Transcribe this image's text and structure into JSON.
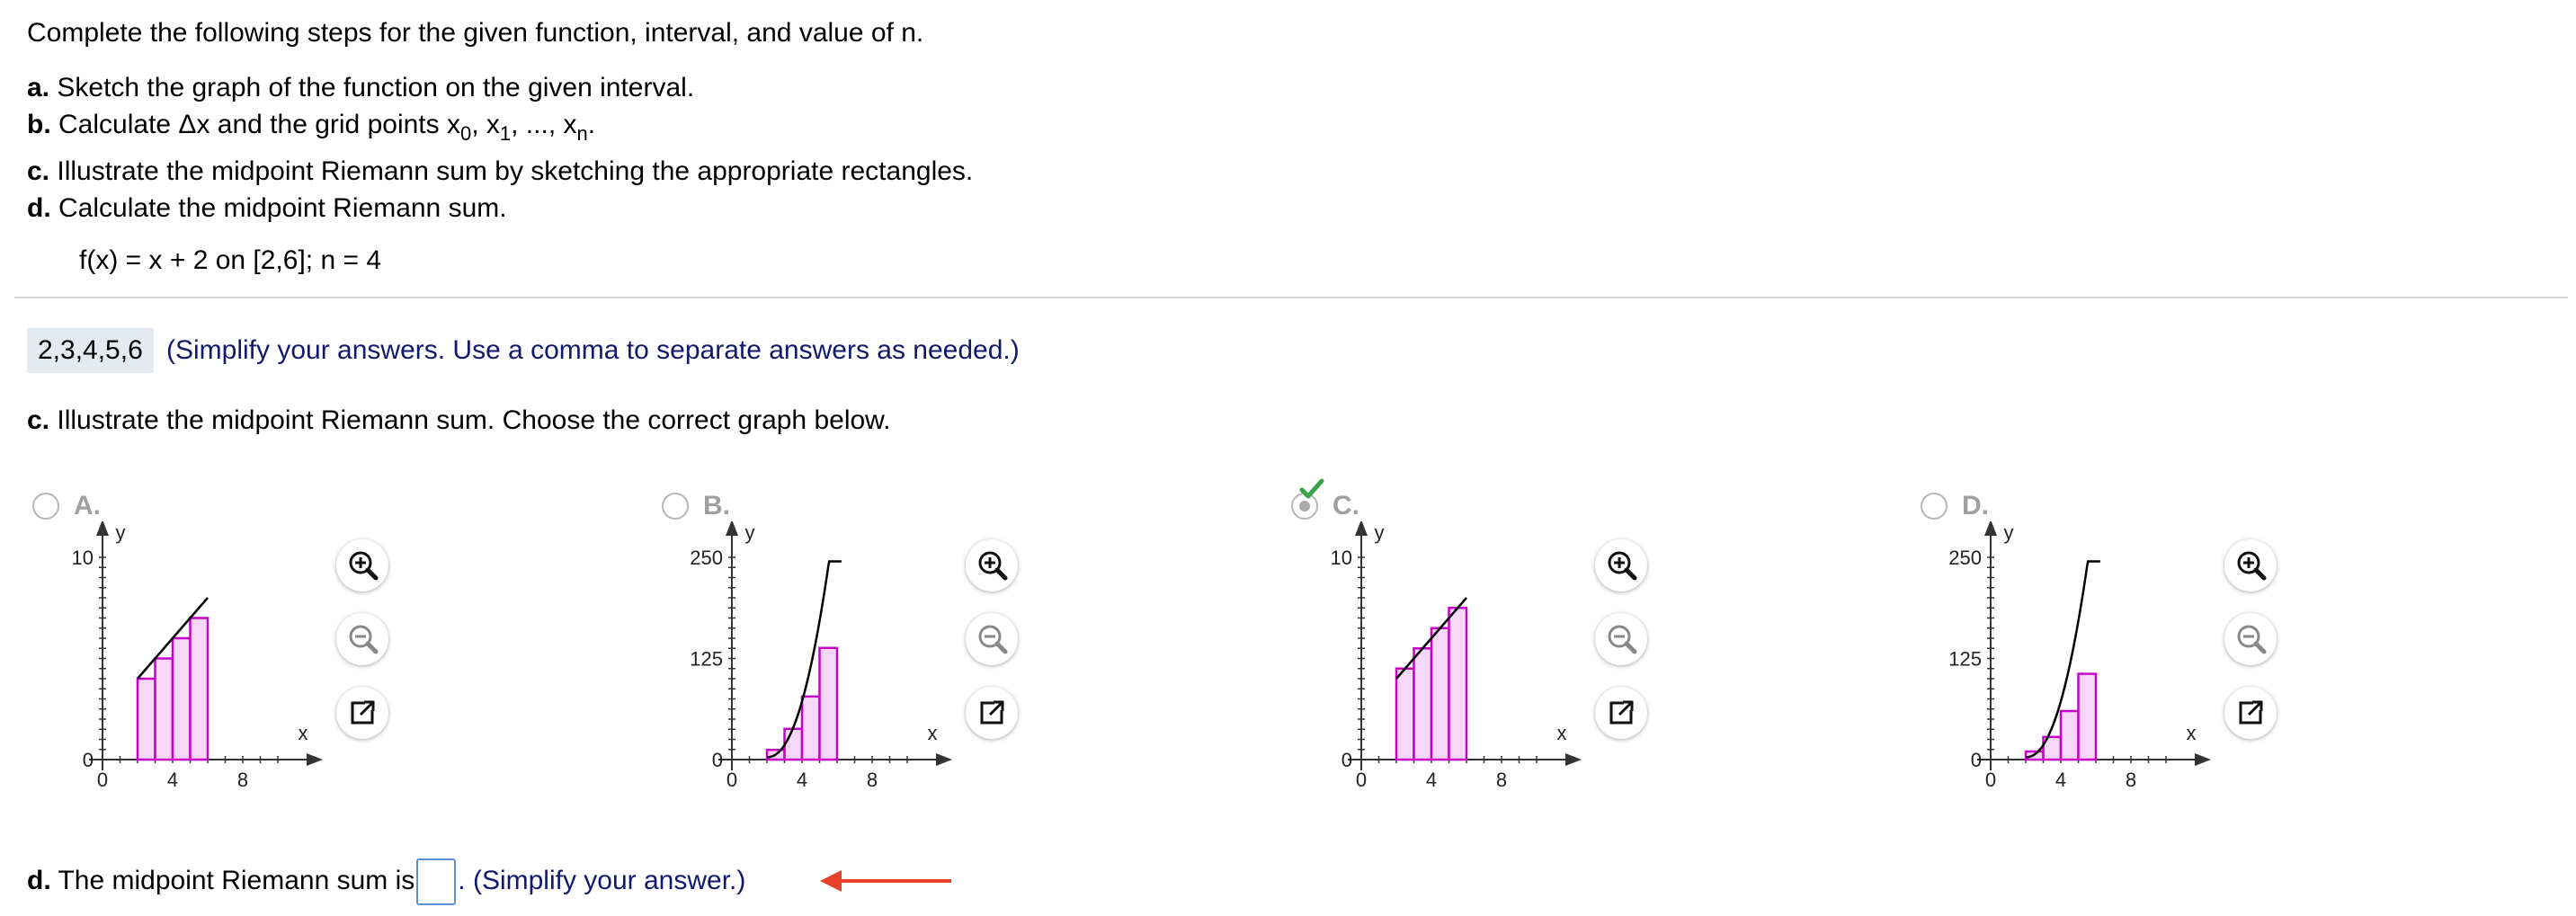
{
  "instructions": {
    "intro": "Complete the following steps for the given function, interval, and value of n.",
    "steps": [
      {
        "letter": "a.",
        "text": "Sketch the graph of the function on the given interval."
      },
      {
        "letter": "b.",
        "text": "Calculate Δx and the grid points x"
      },
      {
        "letter": "c.",
        "text": "Illustrate the midpoint Riemann sum by sketching the appropriate rectangles."
      },
      {
        "letter": "d.",
        "text": "Calculate the midpoint Riemann sum."
      }
    ],
    "grid_subscripts": [
      "0",
      "1",
      "n"
    ],
    "function": "f(x) = x + 2 on [2,6]; n = 4"
  },
  "prior_answer": {
    "value": "2,3,4,5,6",
    "hint": "(Simplify your answers. Use a comma to separate answers as needed.)"
  },
  "part_c": {
    "letter": "c.",
    "text": "Illustrate the midpoint Riemann sum. Choose the correct graph below."
  },
  "options": [
    {
      "label": "A.",
      "selected": false,
      "ymax_label": "10",
      "ymid_label": "",
      "x_ticks": [
        "0",
        "4",
        "8"
      ],
      "axis_x": "x",
      "axis_y": "y"
    },
    {
      "label": "B.",
      "selected": false,
      "ymax_label": "250",
      "ymid_label": "125",
      "x_ticks": [
        "0",
        "4",
        "8"
      ],
      "axis_x": "x",
      "axis_y": "y"
    },
    {
      "label": "C.",
      "selected": true,
      "ymax_label": "10",
      "ymid_label": "",
      "x_ticks": [
        "0",
        "4",
        "8"
      ],
      "axis_x": "x",
      "axis_y": "y"
    },
    {
      "label": "D.",
      "selected": false,
      "ymax_label": "250",
      "ymid_label": "125",
      "x_ticks": [
        "0",
        "4",
        "8"
      ],
      "axis_x": "x",
      "axis_y": "y"
    }
  ],
  "option_charts": [
    {
      "type": "area",
      "xlim": [
        0,
        10
      ],
      "ylim": [
        0,
        10
      ],
      "curve": "x+2",
      "rectangles": [
        {
          "x0": 2,
          "x1": 3,
          "h": 4
        },
        {
          "x0": 3,
          "x1": 4,
          "h": 5
        },
        {
          "x0": 4,
          "x1": 5,
          "h": 6
        },
        {
          "x0": 5,
          "x1": 6,
          "h": 7
        }
      ]
    },
    {
      "type": "area",
      "xlim": [
        0,
        10
      ],
      "ylim": [
        0,
        250
      ],
      "curve": "steep-increasing",
      "rectangles": [
        {
          "x0": 2,
          "x1": 3,
          "h": 12
        },
        {
          "x0": 3,
          "x1": 4,
          "h": 38
        },
        {
          "x0": 4,
          "x1": 5,
          "h": 78
        },
        {
          "x0": 5,
          "x1": 6,
          "h": 138
        }
      ]
    },
    {
      "type": "area",
      "xlim": [
        0,
        10
      ],
      "ylim": [
        0,
        10
      ],
      "curve": "x+2",
      "rectangles": [
        {
          "x0": 2,
          "x1": 3,
          "h": 4.5
        },
        {
          "x0": 3,
          "x1": 4,
          "h": 5.5
        },
        {
          "x0": 4,
          "x1": 5,
          "h": 6.5
        },
        {
          "x0": 5,
          "x1": 6,
          "h": 7.5
        }
      ]
    },
    {
      "type": "area",
      "xlim": [
        0,
        10
      ],
      "ylim": [
        0,
        250
      ],
      "curve": "steep-increasing",
      "rectangles": [
        {
          "x0": 2,
          "x1": 3,
          "h": 10
        },
        {
          "x0": 3,
          "x1": 4,
          "h": 28
        },
        {
          "x0": 4,
          "x1": 5,
          "h": 60
        },
        {
          "x0": 5,
          "x1": 6,
          "h": 106
        }
      ]
    }
  ],
  "tools": {
    "zoom_in": "zoom-in-icon",
    "zoom_out": "zoom-out-icon",
    "popout": "popout-icon"
  },
  "part_d": {
    "letter": "d.",
    "before": "The midpoint Riemann sum is",
    "input_value": "",
    "after": ". (Simplify your answer.)"
  },
  "colors": {
    "hint": "#10196b",
    "rect_stroke": "#c800c8",
    "rect_fill": "#f8d8f8",
    "check": "#3aa34a",
    "arrow": "#e8402a",
    "input_border": "#5f8fd0"
  }
}
